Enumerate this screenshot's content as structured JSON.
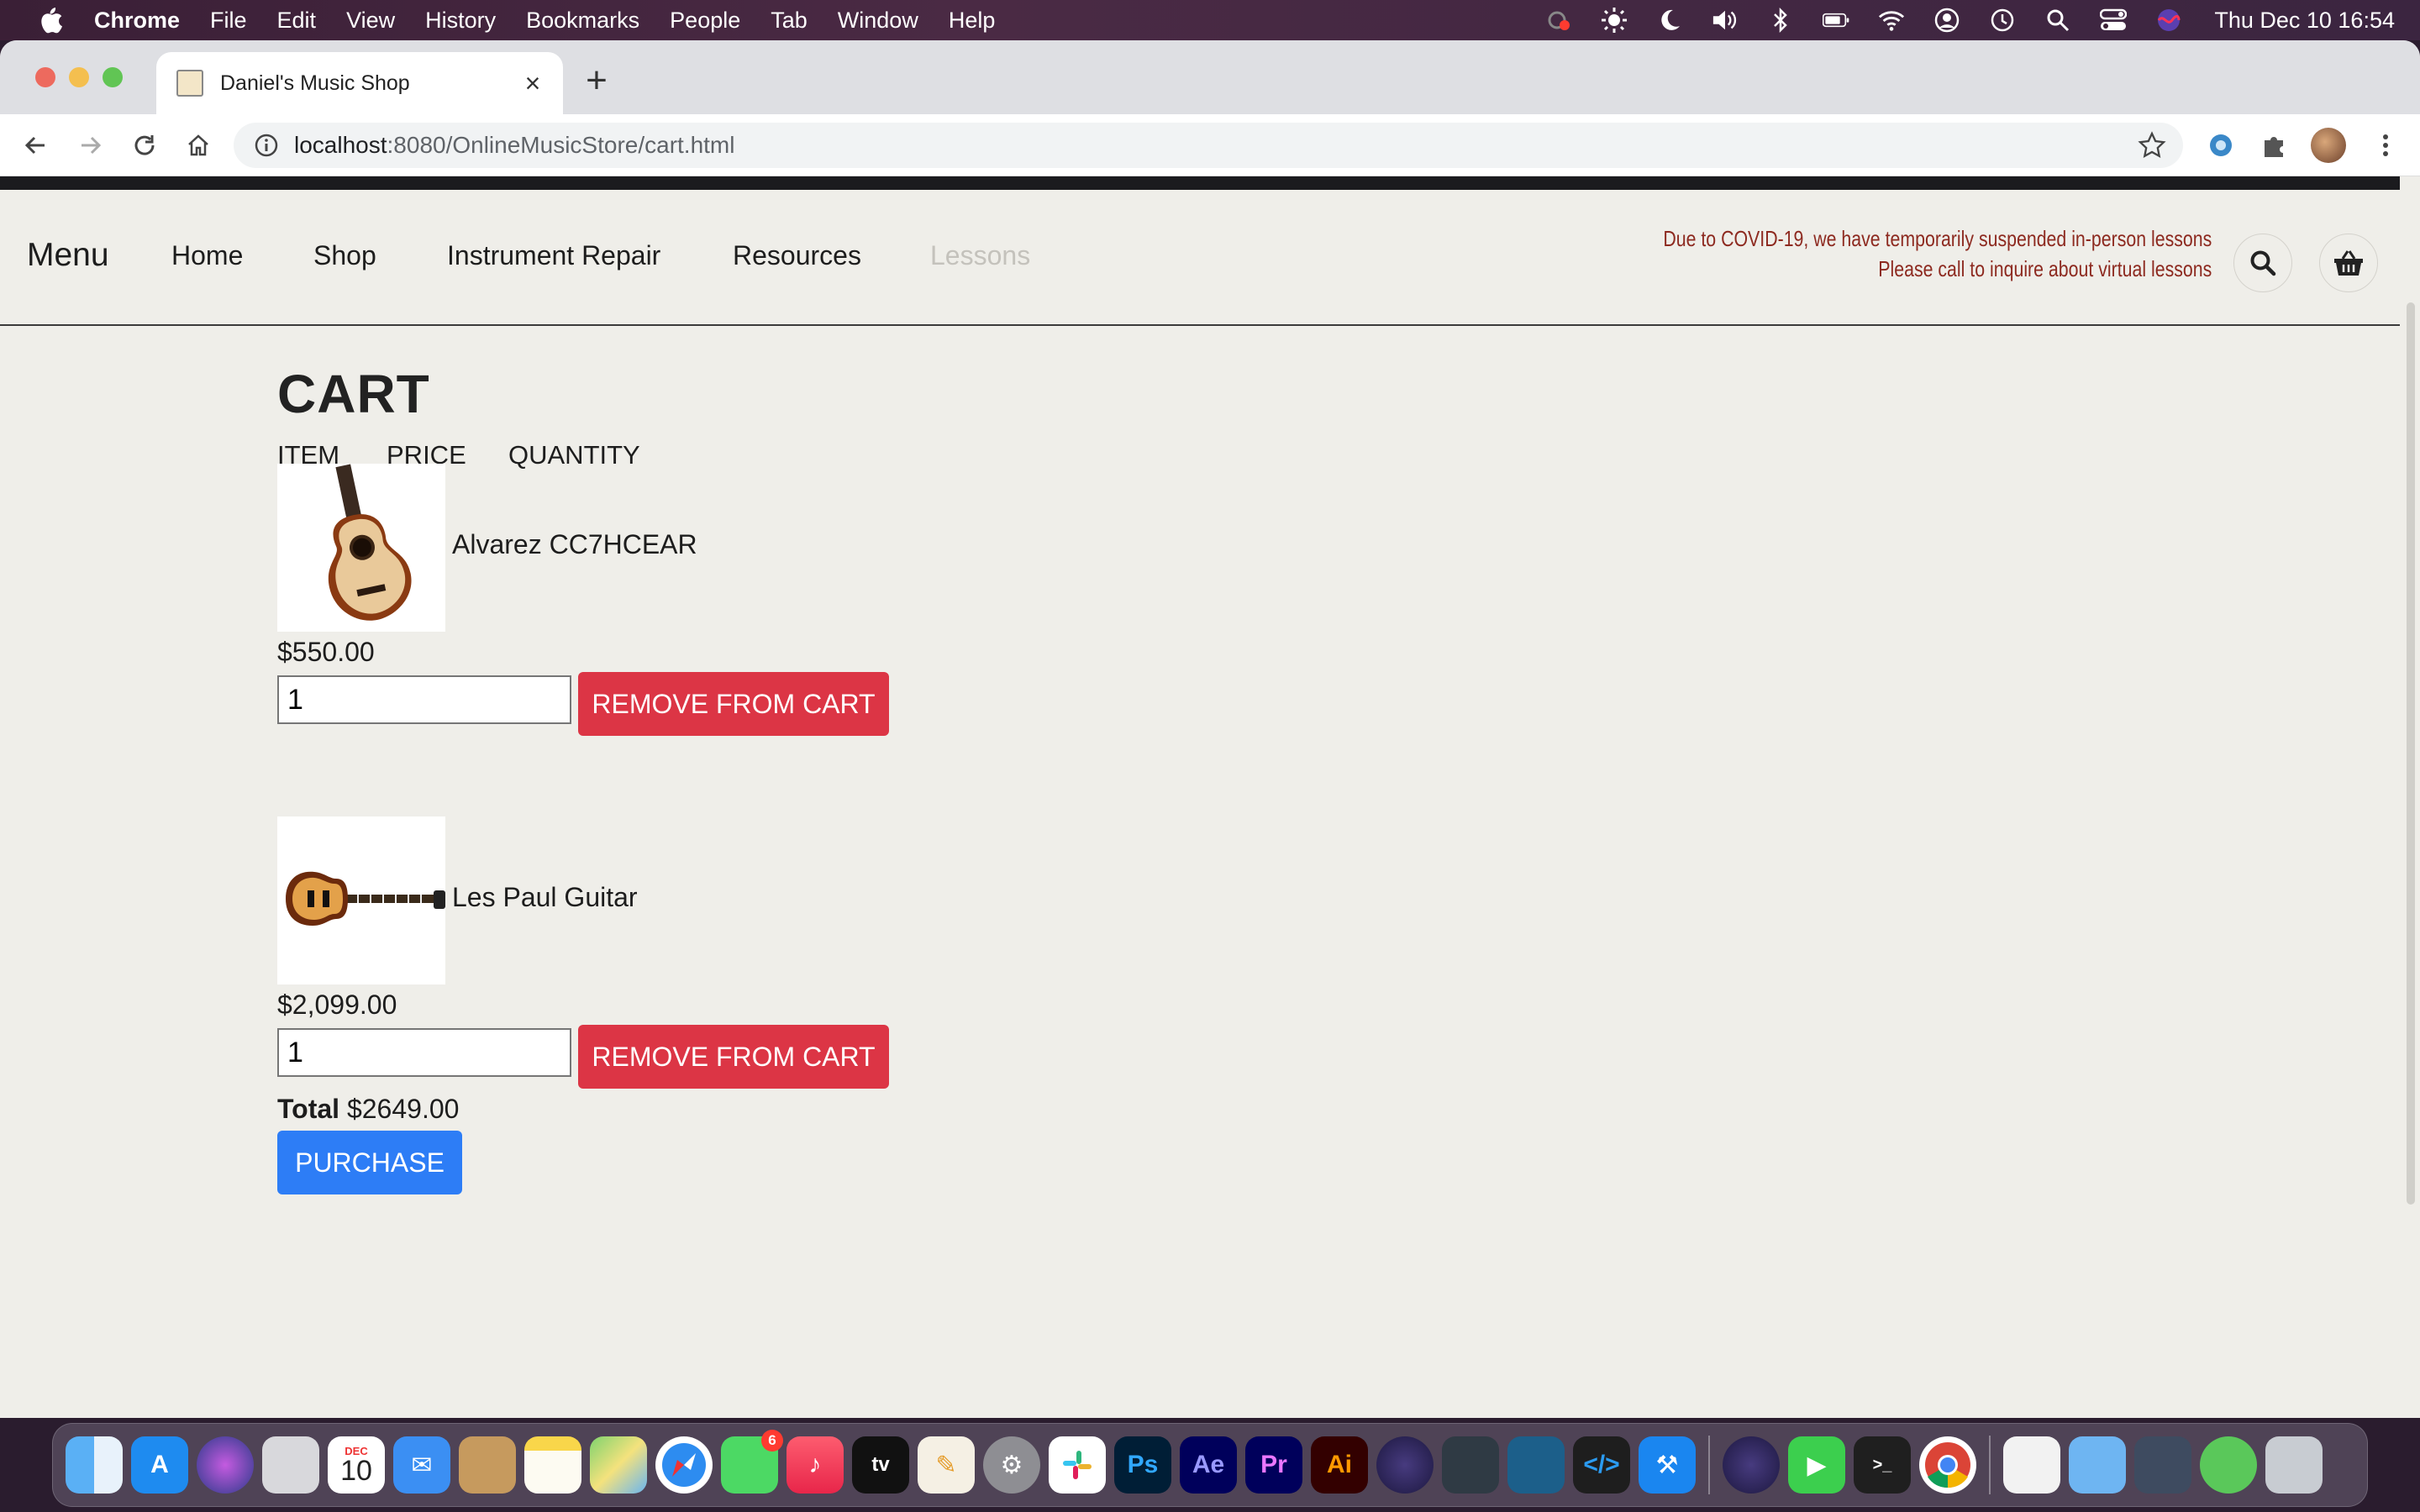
{
  "menubar": {
    "app_name": "Chrome",
    "items": [
      "File",
      "Edit",
      "View",
      "History",
      "Bookmarks",
      "People",
      "Tab",
      "Window",
      "Help"
    ],
    "clock": "Thu Dec 10  16:54",
    "status_icons": [
      "screen-recording-icon",
      "brightness-icon",
      "moon-icon",
      "volume-icon",
      "bluetooth-icon",
      "battery-icon",
      "wifi-icon",
      "user-icon",
      "time-machine-icon",
      "search-icon",
      "control-center-icon",
      "siri-icon"
    ]
  },
  "browser": {
    "tab_title": "Daniel's Music Shop",
    "url_host": "localhost",
    "url_rest": ":8080/OnlineMusicStore/cart.html"
  },
  "site": {
    "menu_label": "Menu",
    "nav": [
      "Home",
      "Shop",
      "Instrument Repair",
      "Resources",
      "Lessons"
    ],
    "notice_line1": "Due to COVID-19, we have temporarily suspended in-person lessons",
    "notice_line2": "Please call to inquire about virtual lessons"
  },
  "cart": {
    "heading": "CART",
    "columns": [
      "ITEM",
      "PRICE",
      "QUANTITY"
    ],
    "items": [
      {
        "name": "Alvarez CC7HCEAR",
        "price": "$550.00",
        "quantity": "1",
        "image": "acoustic-guitar-image"
      },
      {
        "name": "Les Paul Guitar",
        "price": "$2,099.00",
        "quantity": "1",
        "image": "electric-guitar-image"
      }
    ],
    "remove_label": "REMOVE FROM CART",
    "total_label": "Total",
    "total_value": "$2649.00",
    "purchase_label": "PURCHASE"
  },
  "dock": {
    "calendar_month": "DEC",
    "calendar_day": "10",
    "messages_badge": "6",
    "apps": [
      "Finder",
      "App Store",
      "Siri",
      "Launchpad",
      "Calendar",
      "Mail",
      "Contacts",
      "Notes",
      "Maps",
      "Safari",
      "Messages",
      "Music",
      "TV",
      "Pages",
      "System Preferences",
      "Slack",
      "Photoshop",
      "After Effects",
      "Premiere Pro",
      "Illustrator",
      "Eclipse",
      "Android Studio",
      "MySQL Workbench",
      "VS Code",
      "Xcode",
      "Eclipse",
      "FaceTime",
      "Terminal",
      "Chrome",
      "Preview",
      "Downloads",
      "Screenshots",
      "Backup",
      "Trash"
    ],
    "tv_label": "tv",
    "ps_label": "Ps",
    "ae_label": "Ae",
    "pr_label": "Pr",
    "ai_label": "Ai"
  }
}
